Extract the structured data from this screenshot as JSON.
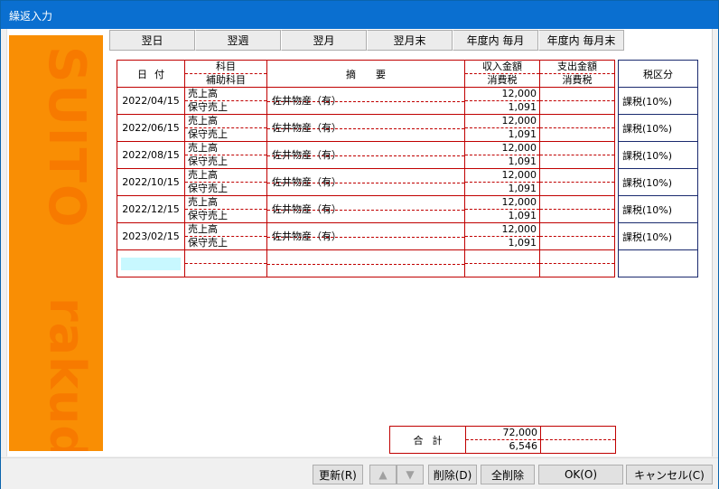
{
  "window": {
    "title": "繰返入力"
  },
  "brand": {
    "word1": "SUITO",
    "word2": "rakuda"
  },
  "tabs": [
    "翌日",
    "翌週",
    "翌月",
    "翌月末",
    "年度内 毎月",
    "年度内 毎月末"
  ],
  "headers": {
    "date": "日付",
    "account": "科目",
    "sub_account": "補助科目",
    "description": "摘要",
    "income": "収入金額",
    "income_tax": "消費税",
    "expense": "支出金額",
    "expense_tax": "消費税",
    "tax_class": "税区分"
  },
  "rows": [
    {
      "date": "2022/04/15",
      "account": "売上高",
      "sub_account": "保守売上",
      "description": "佐井物産（有）",
      "income": "12,000",
      "income_tax": "1,091",
      "expense": "",
      "expense_tax": "",
      "tax_class": "課税(10%)"
    },
    {
      "date": "2022/06/15",
      "account": "売上高",
      "sub_account": "保守売上",
      "description": "佐井物産（有）",
      "income": "12,000",
      "income_tax": "1,091",
      "expense": "",
      "expense_tax": "",
      "tax_class": "課税(10%)"
    },
    {
      "date": "2022/08/15",
      "account": "売上高",
      "sub_account": "保守売上",
      "description": "佐井物産（有）",
      "income": "12,000",
      "income_tax": "1,091",
      "expense": "",
      "expense_tax": "",
      "tax_class": "課税(10%)"
    },
    {
      "date": "2022/10/15",
      "account": "売上高",
      "sub_account": "保守売上",
      "description": "佐井物産（有）",
      "income": "12,000",
      "income_tax": "1,091",
      "expense": "",
      "expense_tax": "",
      "tax_class": "課税(10%)"
    },
    {
      "date": "2022/12/15",
      "account": "売上高",
      "sub_account": "保守売上",
      "description": "佐井物産（有）",
      "income": "12,000",
      "income_tax": "1,091",
      "expense": "",
      "expense_tax": "",
      "tax_class": "課税(10%)"
    },
    {
      "date": "2023/02/15",
      "account": "売上高",
      "sub_account": "保守売上",
      "description": "佐井物産（有）",
      "income": "12,000",
      "income_tax": "1,091",
      "expense": "",
      "expense_tax": "",
      "tax_class": "課税(10%)"
    }
  ],
  "total": {
    "label": "合計",
    "income": "72,000",
    "income_tax": "6,546",
    "expense": "",
    "expense_tax": ""
  },
  "buttons": {
    "update": "更新(R)",
    "up": "▲",
    "down": "▼",
    "delete": "削除(D)",
    "delete_all": "全削除",
    "ok": "OK(O)",
    "cancel": "キャンセル(C)"
  },
  "colors": {
    "brand": "#f98e04",
    "grid_border": "#c00000",
    "tax_border": "#1a2a6e",
    "title_bar": "#0a6fd0",
    "input_highlight": "#c8f8ff"
  }
}
